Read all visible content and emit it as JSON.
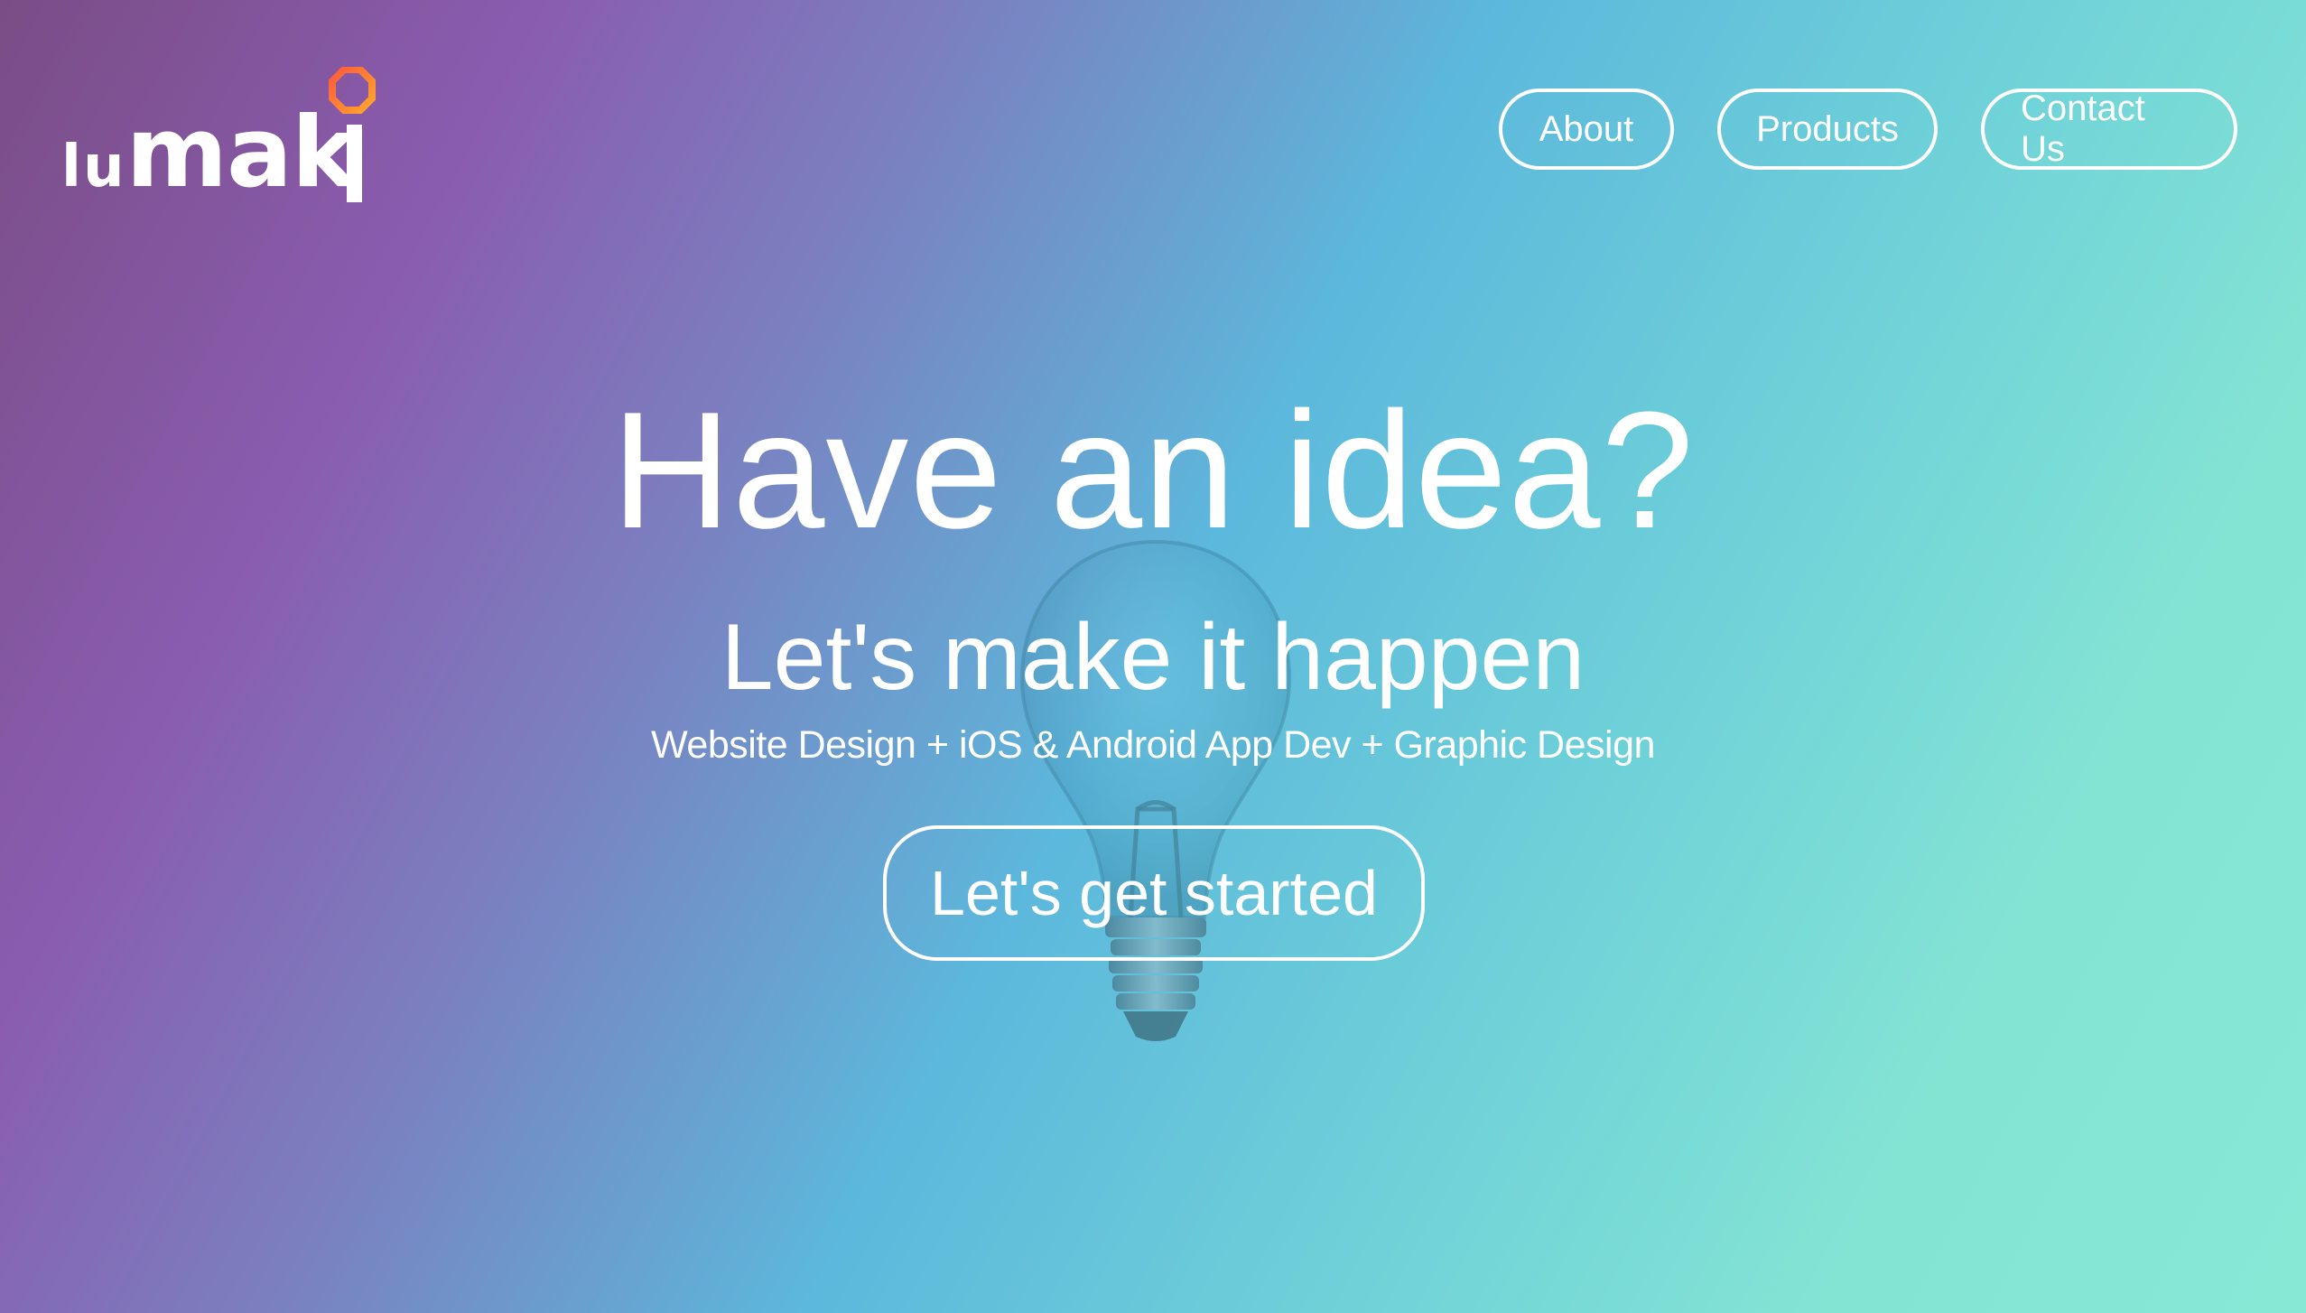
{
  "brand": {
    "logo_text": "lumaki",
    "accent_color": "#ff6a3d",
    "accent_color_2": "#ff9a2e"
  },
  "nav": {
    "items": [
      {
        "label": "About"
      },
      {
        "label": "Products"
      },
      {
        "label": "Contact Us"
      }
    ]
  },
  "hero": {
    "title": "Have an idea?",
    "subtitle": "Let's make it happen",
    "services": "Website Design + iOS & Android App Dev + Graphic Design",
    "cta_label": "Let's get started",
    "background_image": "lightbulb-icon"
  },
  "colors": {
    "gradient_start": "#7a4d86",
    "gradient_mid": "#5cb8dc",
    "gradient_end": "#88e8d6",
    "text": "#ffffff"
  }
}
